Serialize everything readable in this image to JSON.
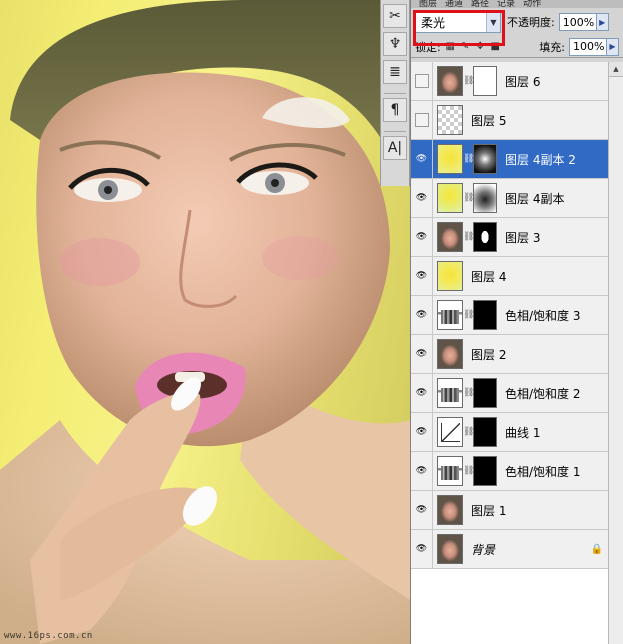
{
  "canvas": {
    "watermark": "www.16ps.com.cn"
  },
  "toolstrip": {
    "icons": [
      "brush-settings-icon",
      "clone-source-icon",
      "tool-presets-icon",
      "paragraph-icon",
      "character-icon"
    ],
    "glyphs": [
      "✂",
      "♆",
      "≣",
      "¶",
      "A|"
    ]
  },
  "panel": {
    "tabs": [
      "图层",
      "通道",
      "路径",
      "记录",
      "动作"
    ],
    "blend_mode": "柔光",
    "opacity_label": "不透明度:",
    "opacity_value": "100%",
    "lock_label": "锁定:",
    "fill_label": "填充:",
    "fill_value": "100%"
  },
  "layers": [
    {
      "name": "图层 6",
      "visible": false,
      "thumb": "face",
      "mask": "white",
      "selected": false
    },
    {
      "name": "图层 5",
      "visible": false,
      "thumb": "check",
      "mask": null,
      "selected": false
    },
    {
      "name": "图层 4副本 2",
      "visible": true,
      "thumb": "yellow",
      "mask": "dark",
      "selected": true
    },
    {
      "name": "图层 4副本",
      "visible": true,
      "thumb": "yellow2",
      "mask": "soft",
      "selected": false
    },
    {
      "name": "图层 3",
      "visible": true,
      "thumb": "face",
      "mask": "face",
      "selected": false
    },
    {
      "name": "图层 4",
      "visible": true,
      "thumb": "yellow",
      "mask": null,
      "selected": false
    },
    {
      "name": "色相/饱和度 3",
      "visible": true,
      "thumb": "adj",
      "mask": "black",
      "selected": false
    },
    {
      "name": "图层 2",
      "visible": true,
      "thumb": "face",
      "mask": null,
      "selected": false
    },
    {
      "name": "色相/饱和度 2",
      "visible": true,
      "thumb": "adj",
      "mask": "black",
      "selected": false
    },
    {
      "name": "曲线 1",
      "visible": true,
      "thumb": "curve",
      "mask": "black",
      "selected": false
    },
    {
      "name": "色相/饱和度 1",
      "visible": true,
      "thumb": "adj",
      "mask": "black",
      "selected": false
    },
    {
      "name": "图层 1",
      "visible": true,
      "thumb": "face",
      "mask": null,
      "selected": false
    },
    {
      "name": "背景",
      "visible": true,
      "thumb": "face",
      "mask": null,
      "selected": false,
      "locked": true
    }
  ]
}
